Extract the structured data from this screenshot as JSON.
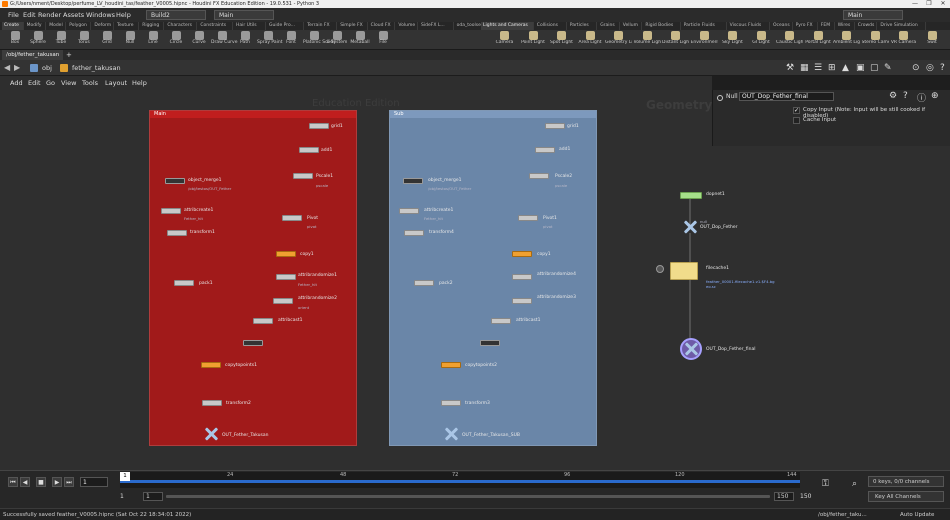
{
  "window": {
    "title": "G:/Users/nment/Desktop/perfume_LV_houdini_tas/feather_V0005.hipnc - Houdini FX Education Edition - 19.0.531 - Python 3",
    "controls": [
      "—",
      "❐",
      "✕"
    ]
  },
  "menubar": {
    "items": [
      "File",
      "Edit",
      "Render",
      "Assets",
      "Windows",
      "Help"
    ],
    "build_tab": "Build2",
    "desktop": "Main",
    "right_desktop": "Main"
  },
  "shelf_tabs_left": [
    "Create",
    "Modify",
    "Model",
    "Polygon",
    "Deform",
    "Texture",
    "Rigging",
    "Characters",
    "Constraints",
    "Hair Utils",
    "Guide Pro...",
    "Terrain FX",
    "Simple FX",
    "Cloud FX",
    "Volume",
    "SideFX L...",
    "oda_toolset"
  ],
  "shelf_tabs_right": [
    "Lights and Cameras",
    "Collisions",
    "Particles",
    "Grains",
    "Vellum",
    "Rigid Bodies",
    "Particle Fluids",
    "Viscous Fluids",
    "Oceans",
    "Pyro FX",
    "FEM",
    "Wires",
    "Crowds",
    "Drive Simulation"
  ],
  "tools_left": [
    "Box",
    "Sphere",
    "Tube",
    "Torus",
    "Grid",
    "Null",
    "Line",
    "Circle",
    "Curve",
    "Draw Curve",
    "Path",
    "Spray Paint",
    "Font",
    "Platonic Solids",
    "L-System",
    "Metaball",
    "File"
  ],
  "tools_right": [
    "Camera",
    "Point Light",
    "Spot Light",
    "Area Light",
    "Geometry Light",
    "Volume Light",
    "Distant Light",
    "Environment Light",
    "Sky Light",
    "GI Light",
    "Caustic Light",
    "Portal Light",
    "Ambient Light",
    "Stereo Camera",
    "VR Camera",
    "Swit"
  ],
  "path_tab": "/obj/fether_takusan",
  "path": {
    "root": "obj",
    "current": "fether_takusan"
  },
  "network_menu": [
    "Add",
    "Edit",
    "Go",
    "View",
    "Tools",
    "Layout",
    "Help"
  ],
  "network": {
    "watermark": "Education Edition",
    "context": "Geometry",
    "box_main": {
      "title": "Main",
      "nodes": {
        "grid1": "grid1",
        "add1": "add1",
        "pscale1": "Pscale1",
        "pscale1_sub": "pscale",
        "pivot": "Pivot",
        "pivot_sub": "pivot",
        "object_merge1": "object_merge1",
        "object_merge1_sub": "/obj/testos/OUT_Fether",
        "attribcreate1": "attribcreate1",
        "attribcreate1_sub": "Fether_hit",
        "transform1": "transform1",
        "copy1": "copy1",
        "attribrandomize1": "attribrandomize1",
        "attribrandomize1_sub": "Fether_hit",
        "attribrandomize2": "attribrandomize2",
        "attribrandomize2_sub": "orient",
        "pack1": "pack1",
        "attribcast1": "attribcast1",
        "copytopoints1": "copytopoints1",
        "transform2": "transform2",
        "out": "OUT_Fether_Takusan"
      }
    },
    "box_sub": {
      "title": "Sub",
      "nodes": {
        "grid1": "grid1",
        "add1": "add1",
        "pscale2": "Pscale2",
        "pscale2_sub": "pscale",
        "pivot1": "Pivot1",
        "pivot1_sub": "pivot",
        "object_merge1": "object_merge1",
        "object_merge1_sub": "/obj/testos/OUT_Fether",
        "attribcreate1": "attribcreate1",
        "attribcreate1_sub": "Fether_hit",
        "transform4": "transform4",
        "copy1": "copy1",
        "attribrandomize4": "attribrandomize4",
        "attribrandomize3": "attribrandomize3",
        "pack2": "pack2",
        "attribcast1": "attribcast1",
        "copytopoints2": "copytopoints2",
        "transform3": "transform3",
        "out": "OUT_Fether_Takusan_SUB"
      }
    },
    "right_nodes": {
      "dopnet1": "dopnet1",
      "out_dop": "OUT_Dop_Fether",
      "out_dop_sub": "null",
      "filecache": "filecache1",
      "filecache_sub": "feather_00001.filecache1.v1.$F4.bg eo.sc",
      "out_final": "OUT_Dop_Fether_final"
    }
  },
  "params": {
    "node_type": "Null",
    "node_name": "OUT_Dop_Fether_final",
    "copy_input": "Copy Input (Note: Input will be still cooked if disabled)",
    "cache_input": "Cache Input"
  },
  "timeline": {
    "ticks": [
      "1",
      "24",
      "48",
      "72",
      "96",
      "120",
      "144"
    ],
    "current_frame": "1",
    "start": "1",
    "range_start": "1",
    "range_end": "150",
    "end": "150",
    "keys": "0 keys, 0/0 channels",
    "channels_btn": "Key All Channels"
  },
  "status": {
    "message": "Successfully saved feather_V0005.hipnc (Sat Oct 22 18:34:01 2022)",
    "path": "/obj/fether_taku...",
    "update": "Auto Update"
  },
  "colors": {
    "main_box": "#a11a1a",
    "sub_box": "#6a86a8",
    "node_orange": "#f0a030"
  }
}
